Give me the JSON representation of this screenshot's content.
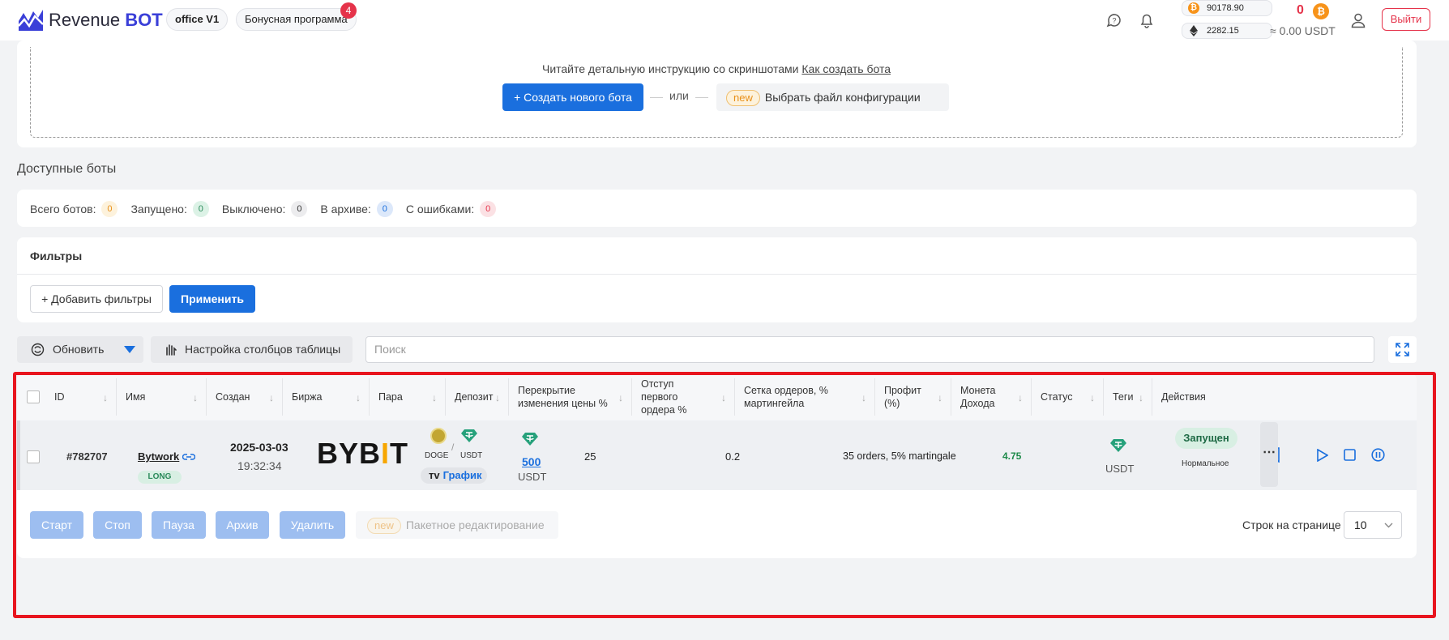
{
  "header": {
    "logo_revenue": "Revenue",
    "logo_bot": "BOT",
    "office": "office V1",
    "bonus": "Бонусная программа",
    "bonus_count": "4",
    "btc_balance": "90178.90",
    "eth_balance": "2282.15",
    "btc_count": "0",
    "btc_symbol": "₿",
    "usdt_total": "≈ 0.00 USDT",
    "logout": "Выйти"
  },
  "create": {
    "instruction": "Читайте детальную инструкцию со скриншотами",
    "instruction_link": "Как создать бота",
    "create_button": "+ Создать нового бота",
    "or": "или",
    "new_tag": "new",
    "config_button": "Выбрать файл конфигурации"
  },
  "available": {
    "title": "Доступные боты",
    "stats": [
      {
        "label": "Всего ботов:",
        "count": "0",
        "bg": "#fdf2dc",
        "fg": "#e8901a"
      },
      {
        "label": "Запущено:",
        "count": "0",
        "bg": "#dcf2e6",
        "fg": "#2a8a5a"
      },
      {
        "label": "Выключено:",
        "count": "0",
        "bg": "#ececee",
        "fg": "#333333"
      },
      {
        "label": "В архиве:",
        "count": "0",
        "bg": "#dce8fa",
        "fg": "#1a6fde"
      },
      {
        "label": "С ошибками:",
        "count": "0",
        "bg": "#fbe1e4",
        "fg": "#e5334a"
      }
    ]
  },
  "filters": {
    "title": "Фильтры",
    "add": "+ Добавить фильтры",
    "apply": "Применить"
  },
  "toolbar": {
    "refresh": "Обновить",
    "columns": "Настройка столбцов таблицы",
    "search_placeholder": "Поиск"
  },
  "table": {
    "columns": [
      "ID",
      "Имя",
      "Создан",
      "Биржа",
      "Пара",
      "Депозит",
      "Перекрытие изменения цены %",
      "Отступ первого ордера %",
      "Сетка ордеров, % мартингейла",
      "Профит (%)",
      "Монета Дохода",
      "Статус",
      "Теги",
      "Действия"
    ],
    "row": {
      "id": "#782707",
      "name": "Bytwork",
      "direction": "LONG",
      "date": "2025-03-03",
      "time": "19:32:34",
      "exchange": "BYBIT",
      "pair_base": "DOGE",
      "pair_sep": "/",
      "pair_quote": "USDT",
      "chart": "График",
      "deposit": "500",
      "deposit_currency": "USDT",
      "overlap": "25",
      "first_offset": "0.2",
      "grid": "35 orders, 5% martingale",
      "profit": "4.75",
      "income_coin": "USDT",
      "status": "Запущен",
      "status_sub": "Нормальное",
      "more": "⋯"
    }
  },
  "bulk": {
    "start": "Старт",
    "stop": "Стоп",
    "pause": "Пауза",
    "archive": "Архив",
    "delete": "Удалить",
    "new_tag": "new",
    "batch_edit": "Пакетное редактирование",
    "rows_per_page": "Строк на странице",
    "rows_value": "10"
  }
}
